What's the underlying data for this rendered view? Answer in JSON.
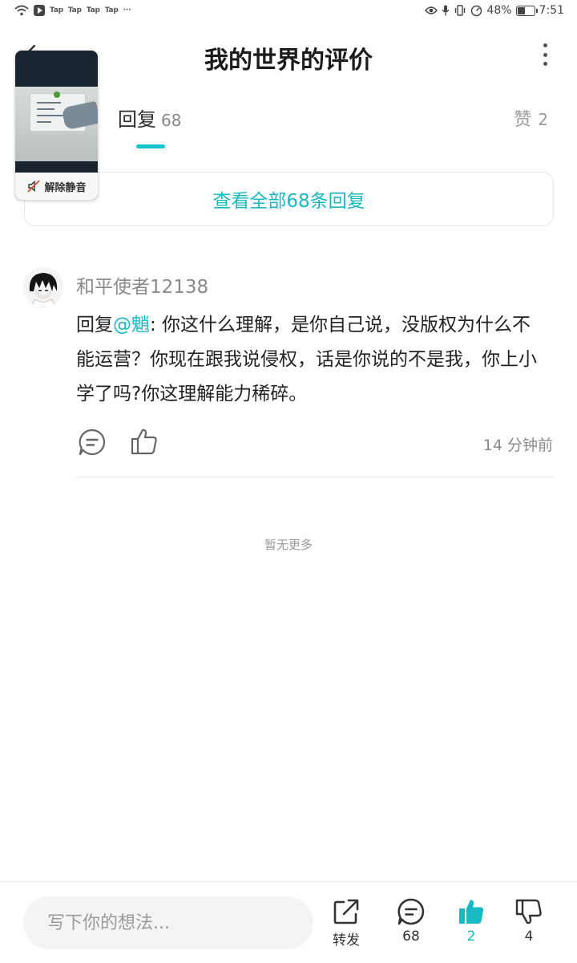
{
  "status_bar": {
    "apps": [
      "Tap",
      "Tap",
      "Tap",
      "Tap"
    ],
    "ellipsis": "···",
    "battery": "48%",
    "time": "7:51"
  },
  "header": {
    "title": "我的世界的评价"
  },
  "pip": {
    "unmute_label": "解除静音"
  },
  "tabs": {
    "reply_label": "回复",
    "reply_count": "68",
    "likes_label": "赞",
    "likes_count": "2"
  },
  "view_all": "查看全部68条回复",
  "comment": {
    "username": "和平使者12138",
    "prefix": "回复",
    "mention": "@魈",
    "text": ": 你这什么理解，是你自己说，没版权为什么不能运营？你现在跟我说侵权，话是你说的不是我，你上小学了吗?你这理解能力稀碎。",
    "timestamp": "14 分钟前"
  },
  "no_more": "暂无更多",
  "bottom_bar": {
    "input_placeholder": "写下你的想法...",
    "share_label": "转发",
    "comment_count": "68",
    "like_count": "2",
    "dislike_count": "4",
    "accent_color": "#18b9c2"
  },
  "icons": [
    "wifi-icon",
    "app-play-icon",
    "eye-icon",
    "mic-icon",
    "vibrate-icon",
    "speed-icon",
    "battery-icon",
    "back-icon",
    "more-icon",
    "mute-icon",
    "reply-icon",
    "like-icon",
    "share-icon",
    "comment-icon",
    "thumbs-up-icon",
    "thumbs-down-icon"
  ]
}
